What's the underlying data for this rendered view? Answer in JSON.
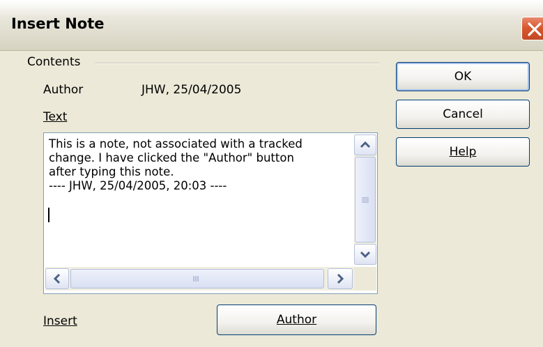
{
  "window": {
    "title": "Insert Note"
  },
  "contents_group": {
    "label": "Contents"
  },
  "author_row": {
    "label": "Author",
    "value": "JHW, 25/04/2005"
  },
  "text_field": {
    "label": "Text",
    "value": "This is a note, not associated with a tracked\nchange. I have clicked the \"Author\" button\nafter typing this note.\n---- JHW, 25/04/2005, 20:03 ----"
  },
  "insert": {
    "label": "Insert",
    "author_button": "Author"
  },
  "buttons": {
    "ok": "OK",
    "cancel": "Cancel",
    "help": "Help"
  },
  "colors": {
    "close_button": "#d6552d",
    "button_border": "#003c74",
    "field_border": "#7f9db9"
  }
}
